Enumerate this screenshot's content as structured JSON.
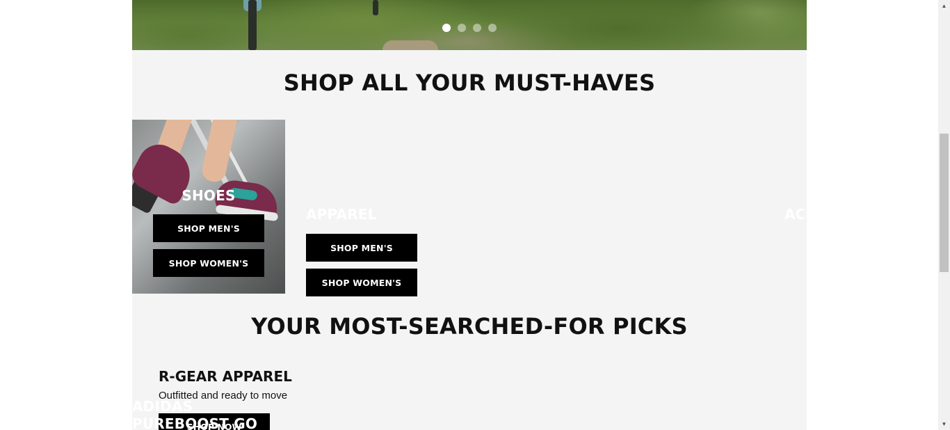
{
  "hero": {
    "slides_count": 4,
    "active_slide": 1
  },
  "sections": {
    "must_haves_title": "SHOP ALL YOUR MUST-HAVES",
    "picks_title": "YOUR MOST-SEARCHED-FOR PICKS"
  },
  "categories": {
    "shoes": {
      "label": "SHOES",
      "men_button": "SHOP MEN'S",
      "women_button": "SHOP WOMEN'S"
    },
    "apparel": {
      "label": "APPAREL",
      "men_button": "SHOP MEN'S",
      "women_button": "SHOP WOMEN'S"
    },
    "accessories": {
      "label_visible": "ACC"
    }
  },
  "picks": {
    "item_title": "R-GEAR APPAREL",
    "item_subtitle": "Outfitted and ready to move",
    "button_label": "SHOP NOW",
    "overlay_line1": "ADIDAS",
    "overlay_line2": "PUREBOOST GO"
  },
  "colors": {
    "content_bg": "#f4f4f4",
    "button_bg": "#000000",
    "button_text": "#ffffff",
    "title_text": "#111111"
  },
  "icons": {
    "scroll_up": "triangle-up-icon",
    "scroll_down": "triangle-down-icon"
  }
}
